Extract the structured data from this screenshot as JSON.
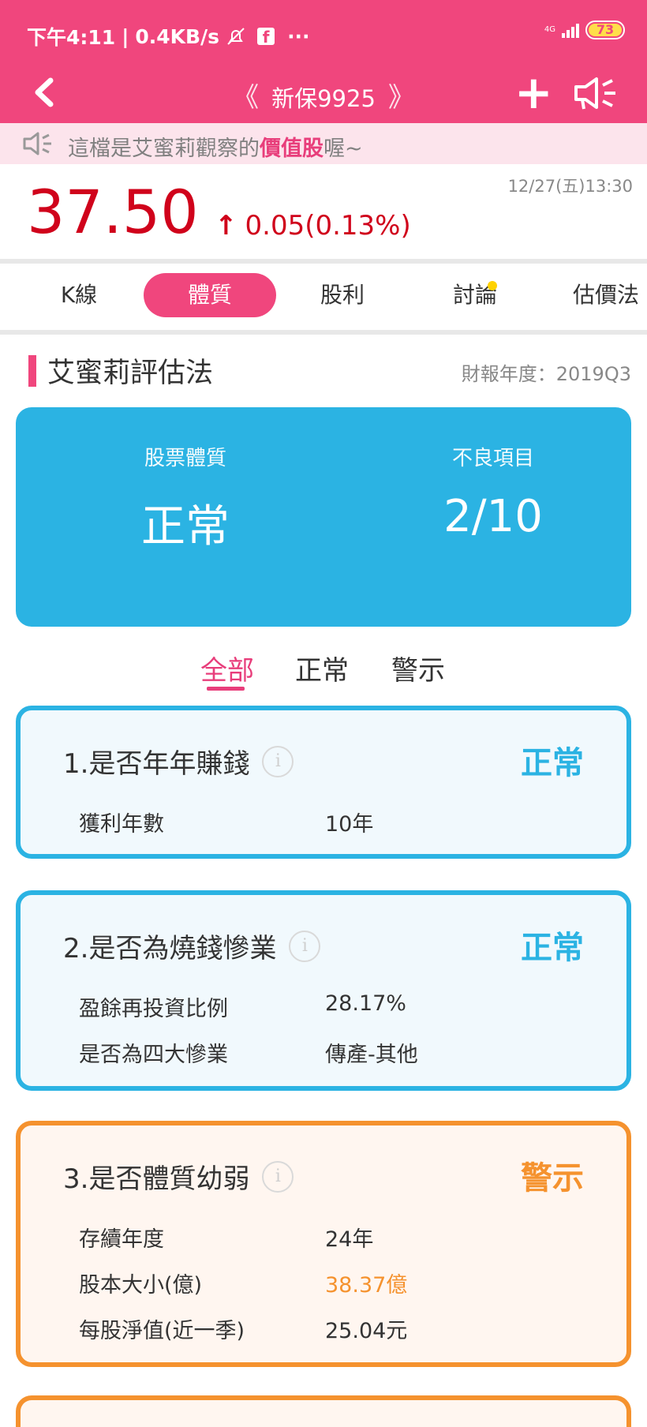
{
  "status_bar": {
    "time": "下午4:11",
    "speed": "0.4KB/s",
    "network": "4G",
    "battery": "73"
  },
  "nav": {
    "title": "新保9925"
  },
  "notice": {
    "prefix": "這檔是艾蜜莉觀察的",
    "highlight": "價值股",
    "suffix": "喔~"
  },
  "quote": {
    "price": "37.50",
    "change": "0.05(0.13%)",
    "time": "12/27(五)13:30"
  },
  "tabs": [
    "K線",
    "體質",
    "股利",
    "討論",
    "估價法"
  ],
  "active_tab": "體質",
  "section": {
    "title": "艾蜜莉評估法",
    "report_year": "財報年度：2019Q3"
  },
  "summary": {
    "quality_label": "股票體質",
    "quality_value": "正常",
    "bad_label": "不良項目",
    "bad_value": "2/10"
  },
  "filters": [
    "全部",
    "正常",
    "警示"
  ],
  "cards": [
    {
      "title": "1.是否年年賺錢",
      "status": "正常",
      "rows": [
        {
          "label": "獲利年數",
          "value": "10年"
        }
      ]
    },
    {
      "title": "2.是否為燒錢慘業",
      "status": "正常",
      "rows": [
        {
          "label": "盈餘再投資比例",
          "value": "28.17%"
        },
        {
          "label": "是否為四大慘業",
          "value": "傳產-其他"
        }
      ]
    },
    {
      "title": "3.是否體質幼弱",
      "status": "警示",
      "rows": [
        {
          "label": "存續年度",
          "value": "24年"
        },
        {
          "label": "股本大小(億)",
          "value": "38.37億"
        },
        {
          "label": "每股淨值(近一季)",
          "value": "25.04元"
        }
      ]
    }
  ],
  "colors": {
    "brand_pink": "#f0467d",
    "normal_blue": "#2bb3e3",
    "warn_orange": "#f5922e",
    "price_red": "#d0021b"
  }
}
